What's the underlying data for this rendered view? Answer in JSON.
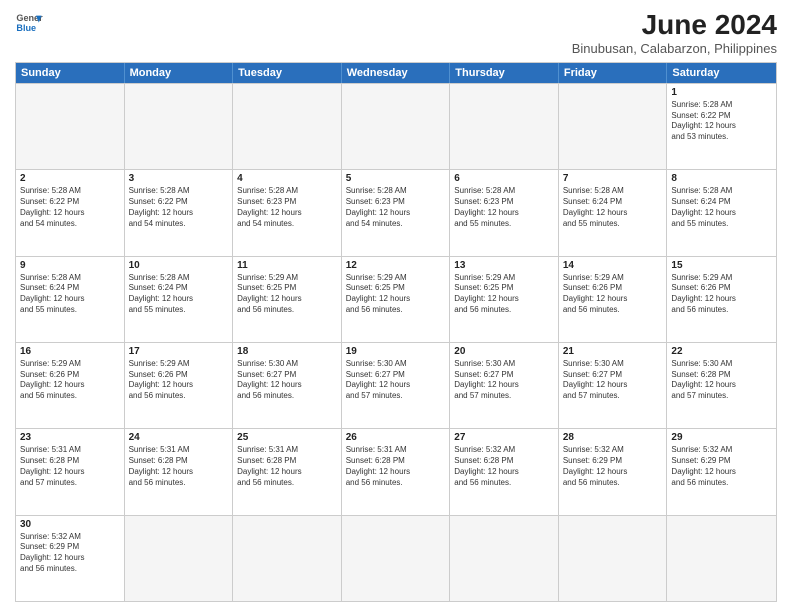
{
  "logo": {
    "line1": "General",
    "line2": "Blue"
  },
  "title": "June 2024",
  "subtitle": "Binubusan, Calabarzon, Philippines",
  "headers": [
    "Sunday",
    "Monday",
    "Tuesday",
    "Wednesday",
    "Thursday",
    "Friday",
    "Saturday"
  ],
  "weeks": [
    [
      {
        "day": "",
        "info": ""
      },
      {
        "day": "",
        "info": ""
      },
      {
        "day": "",
        "info": ""
      },
      {
        "day": "",
        "info": ""
      },
      {
        "day": "",
        "info": ""
      },
      {
        "day": "",
        "info": ""
      },
      {
        "day": "1",
        "info": "Sunrise: 5:28 AM\nSunset: 6:22 PM\nDaylight: 12 hours\nand 53 minutes."
      }
    ],
    [
      {
        "day": "2",
        "info": "Sunrise: 5:28 AM\nSunset: 6:22 PM\nDaylight: 12 hours\nand 54 minutes."
      },
      {
        "day": "3",
        "info": "Sunrise: 5:28 AM\nSunset: 6:22 PM\nDaylight: 12 hours\nand 54 minutes."
      },
      {
        "day": "4",
        "info": "Sunrise: 5:28 AM\nSunset: 6:23 PM\nDaylight: 12 hours\nand 54 minutes."
      },
      {
        "day": "5",
        "info": "Sunrise: 5:28 AM\nSunset: 6:23 PM\nDaylight: 12 hours\nand 54 minutes."
      },
      {
        "day": "6",
        "info": "Sunrise: 5:28 AM\nSunset: 6:23 PM\nDaylight: 12 hours\nand 55 minutes."
      },
      {
        "day": "7",
        "info": "Sunrise: 5:28 AM\nSunset: 6:24 PM\nDaylight: 12 hours\nand 55 minutes."
      },
      {
        "day": "8",
        "info": "Sunrise: 5:28 AM\nSunset: 6:24 PM\nDaylight: 12 hours\nand 55 minutes."
      }
    ],
    [
      {
        "day": "9",
        "info": "Sunrise: 5:28 AM\nSunset: 6:24 PM\nDaylight: 12 hours\nand 55 minutes."
      },
      {
        "day": "10",
        "info": "Sunrise: 5:28 AM\nSunset: 6:24 PM\nDaylight: 12 hours\nand 55 minutes."
      },
      {
        "day": "11",
        "info": "Sunrise: 5:29 AM\nSunset: 6:25 PM\nDaylight: 12 hours\nand 56 minutes."
      },
      {
        "day": "12",
        "info": "Sunrise: 5:29 AM\nSunset: 6:25 PM\nDaylight: 12 hours\nand 56 minutes."
      },
      {
        "day": "13",
        "info": "Sunrise: 5:29 AM\nSunset: 6:25 PM\nDaylight: 12 hours\nand 56 minutes."
      },
      {
        "day": "14",
        "info": "Sunrise: 5:29 AM\nSunset: 6:26 PM\nDaylight: 12 hours\nand 56 minutes."
      },
      {
        "day": "15",
        "info": "Sunrise: 5:29 AM\nSunset: 6:26 PM\nDaylight: 12 hours\nand 56 minutes."
      }
    ],
    [
      {
        "day": "16",
        "info": "Sunrise: 5:29 AM\nSunset: 6:26 PM\nDaylight: 12 hours\nand 56 minutes."
      },
      {
        "day": "17",
        "info": "Sunrise: 5:29 AM\nSunset: 6:26 PM\nDaylight: 12 hours\nand 56 minutes."
      },
      {
        "day": "18",
        "info": "Sunrise: 5:30 AM\nSunset: 6:27 PM\nDaylight: 12 hours\nand 56 minutes."
      },
      {
        "day": "19",
        "info": "Sunrise: 5:30 AM\nSunset: 6:27 PM\nDaylight: 12 hours\nand 57 minutes."
      },
      {
        "day": "20",
        "info": "Sunrise: 5:30 AM\nSunset: 6:27 PM\nDaylight: 12 hours\nand 57 minutes."
      },
      {
        "day": "21",
        "info": "Sunrise: 5:30 AM\nSunset: 6:27 PM\nDaylight: 12 hours\nand 57 minutes."
      },
      {
        "day": "22",
        "info": "Sunrise: 5:30 AM\nSunset: 6:28 PM\nDaylight: 12 hours\nand 57 minutes."
      }
    ],
    [
      {
        "day": "23",
        "info": "Sunrise: 5:31 AM\nSunset: 6:28 PM\nDaylight: 12 hours\nand 57 minutes."
      },
      {
        "day": "24",
        "info": "Sunrise: 5:31 AM\nSunset: 6:28 PM\nDaylight: 12 hours\nand 56 minutes."
      },
      {
        "day": "25",
        "info": "Sunrise: 5:31 AM\nSunset: 6:28 PM\nDaylight: 12 hours\nand 56 minutes."
      },
      {
        "day": "26",
        "info": "Sunrise: 5:31 AM\nSunset: 6:28 PM\nDaylight: 12 hours\nand 56 minutes."
      },
      {
        "day": "27",
        "info": "Sunrise: 5:32 AM\nSunset: 6:28 PM\nDaylight: 12 hours\nand 56 minutes."
      },
      {
        "day": "28",
        "info": "Sunrise: 5:32 AM\nSunset: 6:29 PM\nDaylight: 12 hours\nand 56 minutes."
      },
      {
        "day": "29",
        "info": "Sunrise: 5:32 AM\nSunset: 6:29 PM\nDaylight: 12 hours\nand 56 minutes."
      }
    ],
    [
      {
        "day": "30",
        "info": "Sunrise: 5:32 AM\nSunset: 6:29 PM\nDaylight: 12 hours\nand 56 minutes."
      },
      {
        "day": "",
        "info": ""
      },
      {
        "day": "",
        "info": ""
      },
      {
        "day": "",
        "info": ""
      },
      {
        "day": "",
        "info": ""
      },
      {
        "day": "",
        "info": ""
      },
      {
        "day": "",
        "info": ""
      }
    ]
  ]
}
